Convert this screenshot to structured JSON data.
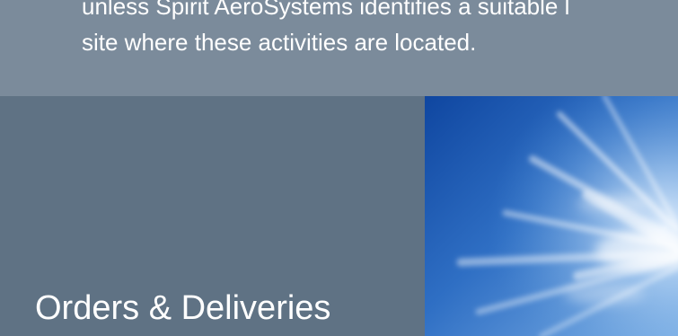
{
  "intro": {
    "line1": "unless Spirit AeroSystems identifies a suitable l",
    "line2": "site where these activities are located."
  },
  "section": {
    "title": "Orders & Deliveries"
  },
  "hero_image": {
    "subject": "blue-sky-with-wispy-clouds"
  },
  "colors": {
    "top_band": "#7b8b9b",
    "panel": "#5f7284",
    "text": "#ffffff",
    "sky_dark": "#1450a8",
    "sky_light": "#4d8fd6"
  }
}
